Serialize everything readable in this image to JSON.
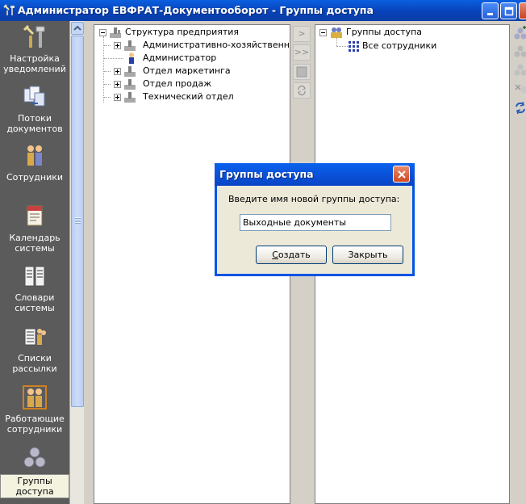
{
  "window": {
    "title": "Администратор ЕВФРАТ-Документооборот - Группы доступа"
  },
  "nav": {
    "items": [
      {
        "label": "Настройка уведомлений",
        "icon": "tools-icon"
      },
      {
        "label": "Потоки документов",
        "icon": "documents-flow-icon"
      },
      {
        "label": "Сотрудники",
        "icon": "employees-icon"
      },
      {
        "label": "Календарь системы",
        "icon": "calendar-icon"
      },
      {
        "label": "Словари системы",
        "icon": "dictionaries-icon"
      },
      {
        "label": "Списки рассылки",
        "icon": "mailing-lists-icon"
      },
      {
        "label": "Работающие сотрудники",
        "icon": "working-employees-icon"
      },
      {
        "label": "Группы доступа",
        "icon": "access-groups-icon",
        "active": true
      }
    ]
  },
  "left_tree": {
    "root": "Структура предприятия",
    "children": [
      "Административно-хозяйственный о",
      "Администратор",
      "Отдел маркетинга",
      "Отдел продаж",
      "Технический отдел"
    ]
  },
  "middle_buttons": [
    ">",
    ">>"
  ],
  "right_tree": {
    "root": "Группы доступа",
    "children": [
      "Все сотрудники"
    ]
  },
  "dialog": {
    "title": "Группы доступа",
    "prompt": "Введите имя новой группы доступа:",
    "input_value": "Выходные документы",
    "create_first": "С",
    "create_rest": "оздать",
    "close_label": "Закрыть"
  }
}
